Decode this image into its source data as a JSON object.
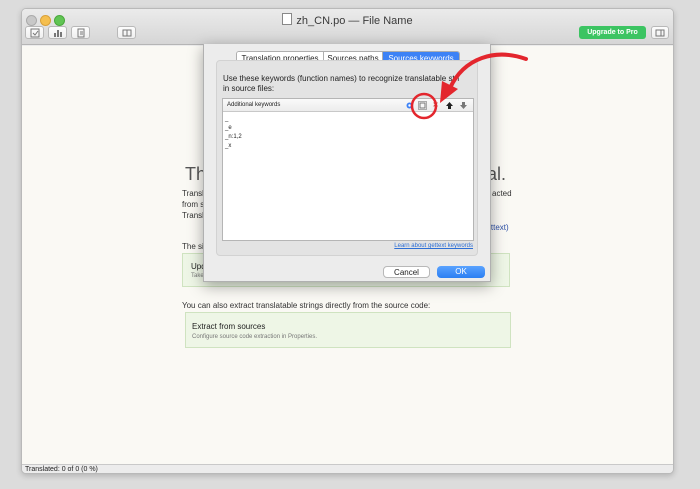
{
  "window": {
    "title": "zh_CN.po — File Name",
    "upgrade_label": "Upgrade to Pro"
  },
  "colors": {
    "accent": "#3d82f6",
    "upgrade_green": "#3cc462",
    "annotation_red": "#e3262d"
  },
  "background": {
    "heading_left": "Th",
    "heading_right": "al.",
    "para_line1": "Translat",
    "para_line1_right": "acted",
    "para_line2": "from s",
    "para_line3": "Transla",
    "para_line3_right": "gettext)",
    "section_line": "The si",
    "update_box_title": "Upd",
    "update_box_sub": "Take",
    "extract_intro": "You can also extract translatable strings directly from the source code:",
    "extract_title": "Extract from sources",
    "extract_sub": "Configure source code extraction in Properties."
  },
  "status": {
    "text": "Translated: 0 of 0 (0 %)"
  },
  "dialog": {
    "tabs": [
      {
        "label": "Translation properties",
        "active": false
      },
      {
        "label": "Sources paths",
        "active": false
      },
      {
        "label": "Sources keywords",
        "active": true
      }
    ],
    "description_line1": "Use these keywords (function names) to recognize translatable stri",
    "description_line2": "in source files:",
    "list_header": "Additional keywords",
    "keywords": [
      "_",
      "_e",
      "_n:1,2",
      "_x"
    ],
    "learn_link": "Learn about gettext keywords",
    "cancel_label": "Cancel",
    "ok_label": "OK"
  },
  "icons": {
    "add": "add-keyword-icon",
    "edit": "edit-keyword-icon",
    "remove": "remove-keyword-icon",
    "move_up": "move-up-icon",
    "move_down": "move-down-icon"
  }
}
